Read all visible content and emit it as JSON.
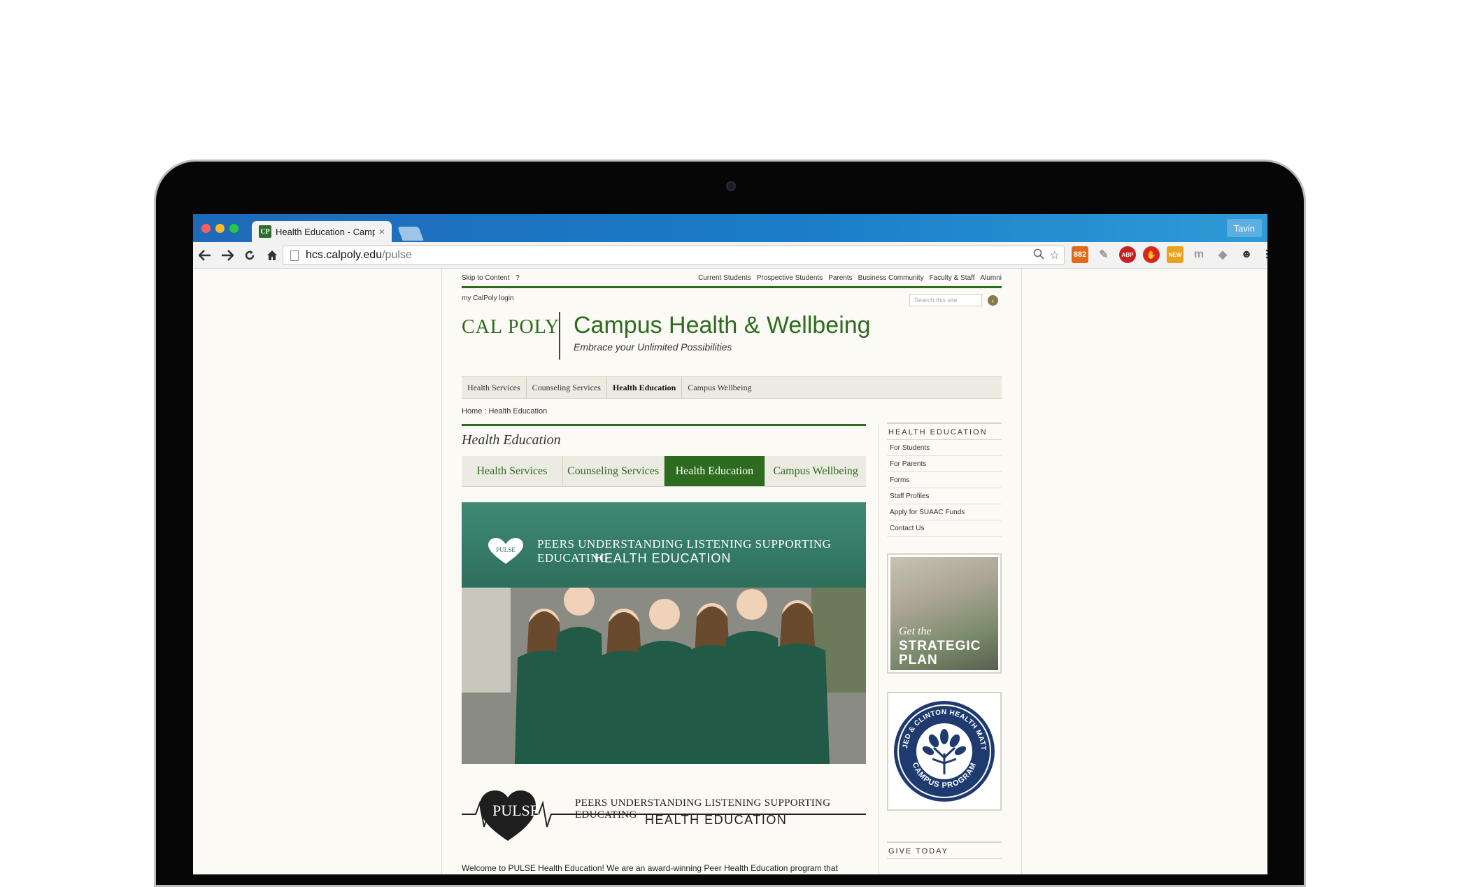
{
  "browser": {
    "tab_title": "Health Education - Campus",
    "tab_favicon": "CP",
    "profile_name": "Tavin",
    "url_host": "hcs.calpoly.edu",
    "url_path": "/pulse",
    "ext_rss_badge": "882",
    "ext_abp": "ABP",
    "ext_new": "NEW",
    "ext_m": "m"
  },
  "site": {
    "skip_link": "Skip to Content",
    "help_mark": "?",
    "audience_links": [
      "Current Students",
      "Prospective Students",
      "Parents",
      "Business Community",
      "Faculty & Staff",
      "Alumni"
    ],
    "login": "my CalPoly login",
    "search_placeholder": "Search this site",
    "logo": "CAL POLY",
    "title": "Campus Health & Wellbeing",
    "tagline": "Embrace your Unlimited Possibilities",
    "main_nav": [
      "Health Services",
      "Counseling Services",
      "Health Education",
      "Campus Wellbeing"
    ],
    "breadcrumb": "Home : Health Education",
    "page_heading": "Health Education",
    "sub_tabs": [
      "Health Services",
      "Counseling Services",
      "Health Education",
      "Campus Wellbeing"
    ],
    "hero_banner_line1": "PEERS UNDERSTANDING LISTENING SUPPORTING EDUCATING",
    "hero_banner_line2": "HEALTH EDUCATION",
    "hero_heart_label": "PULSE",
    "pulse_word": "PULSE",
    "pulse_line1": "PEERS UNDERSTANDING LISTENING SUPPORTING EDUCATING",
    "pulse_line2": "HEALTH EDUCATION",
    "welcome_text": "Welcome to PULSE Health Education! We are an award-winning Peer Health Education program that"
  },
  "sidebar": {
    "heading": "HEALTH EDUCATION",
    "links": [
      "For Students",
      "For Parents",
      "Forms",
      "Staff Profiles",
      "Apply for SUAAC Funds",
      "Contact Us"
    ],
    "promo_line1": "Get the",
    "promo_line2": "STRATEGIC",
    "promo_line3": "PLAN",
    "jed_arc_top": "THE JED & CLINTON HEALTH MATTERS",
    "jed_arc_bottom": "CAMPUS PROGRAM",
    "give_heading": "GIVE TODAY"
  },
  "colors": {
    "brand_green": "#2d6b1f",
    "tab_bar": "#1a7cc8",
    "jed_navy": "#1e3a6e"
  }
}
